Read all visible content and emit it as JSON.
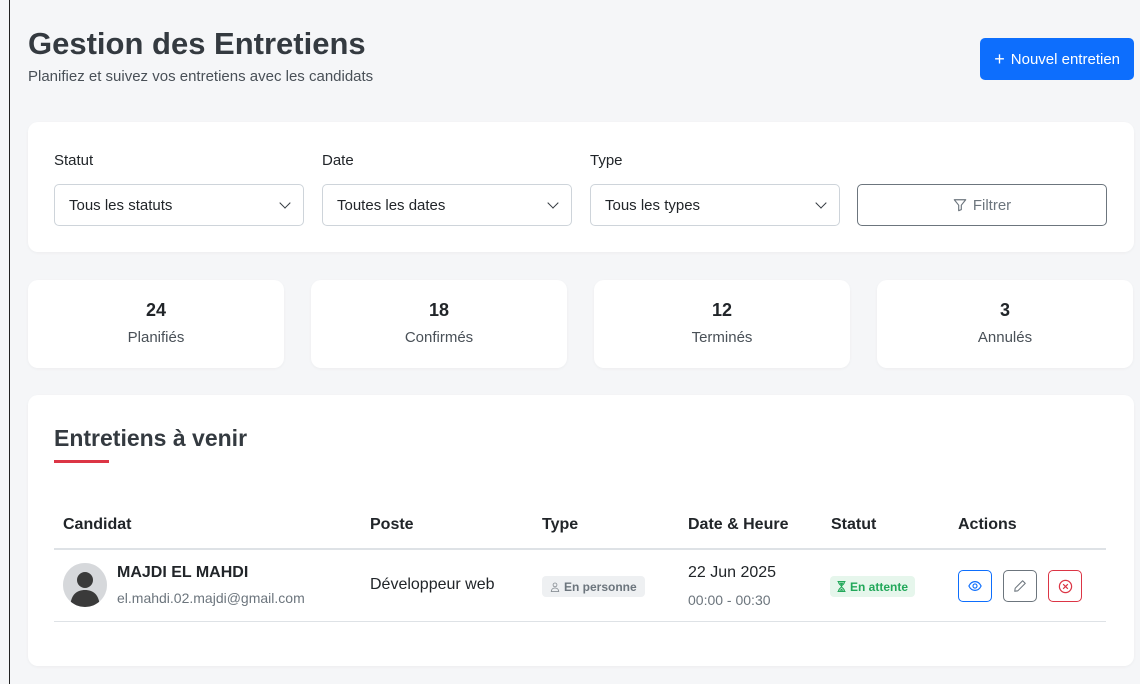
{
  "header": {
    "title": "Gestion des Entretiens",
    "subtitle": "Planifiez et suivez vos entretiens avec les candidats",
    "new_button_label": "Nouvel entretien",
    "new_button_icon": "plus-icon"
  },
  "filters": {
    "status_label": "Statut",
    "status_value": "Tous les statuts",
    "date_label": "Date",
    "date_value": "Toutes les dates",
    "type_label": "Type",
    "type_value": "Tous les types",
    "filter_button_label": "Filtrer",
    "filter_button_icon": "funnel-icon"
  },
  "stats": [
    {
      "value": "24",
      "label": "Planifiés"
    },
    {
      "value": "18",
      "label": "Confirmés"
    },
    {
      "value": "12",
      "label": "Terminés"
    },
    {
      "value": "3",
      "label": "Annulés"
    }
  ],
  "upcoming": {
    "title": "Entretiens à venir",
    "accent_color": "#dc3545",
    "columns": [
      "Candidat",
      "Poste",
      "Type",
      "Date & Heure",
      "Statut",
      "Actions"
    ],
    "rows": [
      {
        "candidate_name": "MAJDI EL MAHDI",
        "candidate_email": "el.mahdi.02.majdi@gmail.com",
        "position": "Développeur web",
        "type": "En personne",
        "date": "22 Jun 2025",
        "time": "00:00 - 00:30",
        "status": "En attente",
        "status_color": "#22a85a",
        "actions": [
          "eye-icon",
          "pencil-icon",
          "x-circle-icon"
        ]
      }
    ]
  },
  "colors": {
    "primary": "#0d6efd",
    "danger": "#dc3545",
    "success": "#22a85a",
    "background": "#f5f6f8"
  }
}
